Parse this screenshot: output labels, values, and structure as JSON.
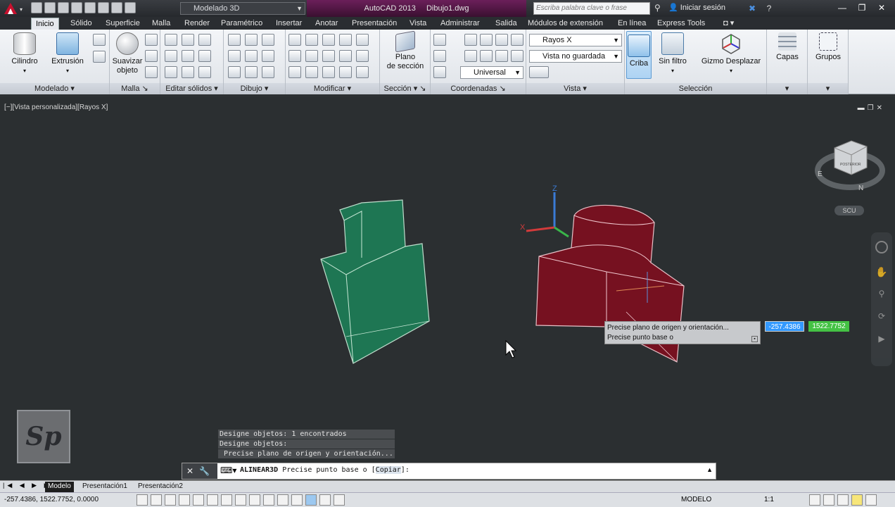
{
  "titlebar": {
    "workspace": "Modelado 3D",
    "app_name": "AutoCAD 2013",
    "file_name": "Dibujo1.dwg",
    "search_placeholder": "Escriba palabra clave o frase",
    "login": "Iniciar sesión"
  },
  "tabs": [
    "Inicio",
    "Sólido",
    "Superficie",
    "Malla",
    "Render",
    "Paramétrico",
    "Insertar",
    "Anotar",
    "Presentación",
    "Vista",
    "Administrar",
    "Salida",
    "Módulos de extensión",
    "En línea",
    "Express Tools"
  ],
  "ribbon": {
    "panels": {
      "modelado": "Modelado",
      "malla": "Malla",
      "editar_solidos": "Editar sólidos",
      "dibujo": "Dibujo",
      "modificar": "Modificar",
      "seccion": "Sección",
      "coordenadas": "Coordenadas",
      "vista": "Vista",
      "seleccion": "Selección"
    },
    "buttons": {
      "cilindro": "Cilindro",
      "extrusion": "Extrusión",
      "suavizar_1": "Suavizar",
      "suavizar_2": "objeto",
      "plano_1": "Plano",
      "plano_2": "de sección",
      "criba": "Criba",
      "sin_filtro": "Sin filtro",
      "gizmo": "Gizmo Desplazar",
      "capas": "Capas",
      "grupos": "Grupos"
    },
    "combos": {
      "visual_style": "Rayos X",
      "view": "Vista no guardada",
      "ucs": "Universal"
    }
  },
  "viewport": {
    "label": "[−][Vista personalizada][Rayos X]",
    "viewcube_text": "POSTERIOR",
    "ucs_badge": "SCU",
    "tooltip_line1": "Precise plano de origen y orientación...",
    "tooltip_line2": "Precise punto base o",
    "dyn_x": "-257.4386",
    "dyn_y": "1522.7752",
    "logo": "Sp"
  },
  "history": [
    "Designe objetos: 1 encontrados",
    "Designe objetos:",
    " Precise plano de origen y orientación..."
  ],
  "cmdline": {
    "command": "ALINEAR3D",
    "prompt": "Precise punto base o [",
    "option": "Copiar",
    "end": "]:"
  },
  "layout_tabs": [
    "Modelo",
    "Presentación1",
    "Presentación2"
  ],
  "status": {
    "coords": "-257.4386, 1522.7752, 0.0000",
    "model": "MODELO",
    "scale": "1:1"
  }
}
